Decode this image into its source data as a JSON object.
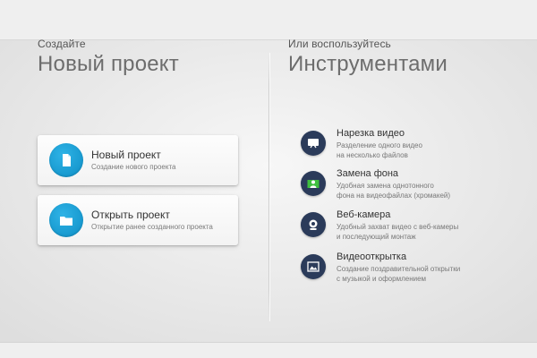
{
  "left": {
    "subheading": "Создайте",
    "heading": "Новый проект",
    "cards": [
      {
        "title": "Новый проект",
        "desc": "Создание нового проекта",
        "icon": "document-icon"
      },
      {
        "title": "Открыть проект",
        "desc": "Открытие ранее созданного проекта",
        "icon": "folder-icon"
      }
    ]
  },
  "right": {
    "subheading": "Или воспользуйтесь",
    "heading": "Инструментами",
    "tools": [
      {
        "title": "Нарезка видео",
        "desc_line1": "Разделение одного видео",
        "desc_line2": "на несколько файлов",
        "icon": "video-cut-icon"
      },
      {
        "title": "Замена фона",
        "desc_line1": "Удобная замена однотонного",
        "desc_line2": "фона на видеофайлах (хромакей)",
        "icon": "chroma-key-icon"
      },
      {
        "title": "Веб-камера",
        "desc_line1": "Удобный захват видео с веб-камеры",
        "desc_line2": "и последующий монтаж",
        "icon": "webcam-icon"
      },
      {
        "title": "Видеооткрытка",
        "desc_line1": "Создание поздравительной открытки",
        "desc_line2": "с музыкой и оформлением",
        "icon": "postcard-icon"
      }
    ]
  },
  "colors": {
    "accent_blue": "#1799cf",
    "tool_circle": "#2b3b5a",
    "chroma_green": "#3fbf3f"
  }
}
